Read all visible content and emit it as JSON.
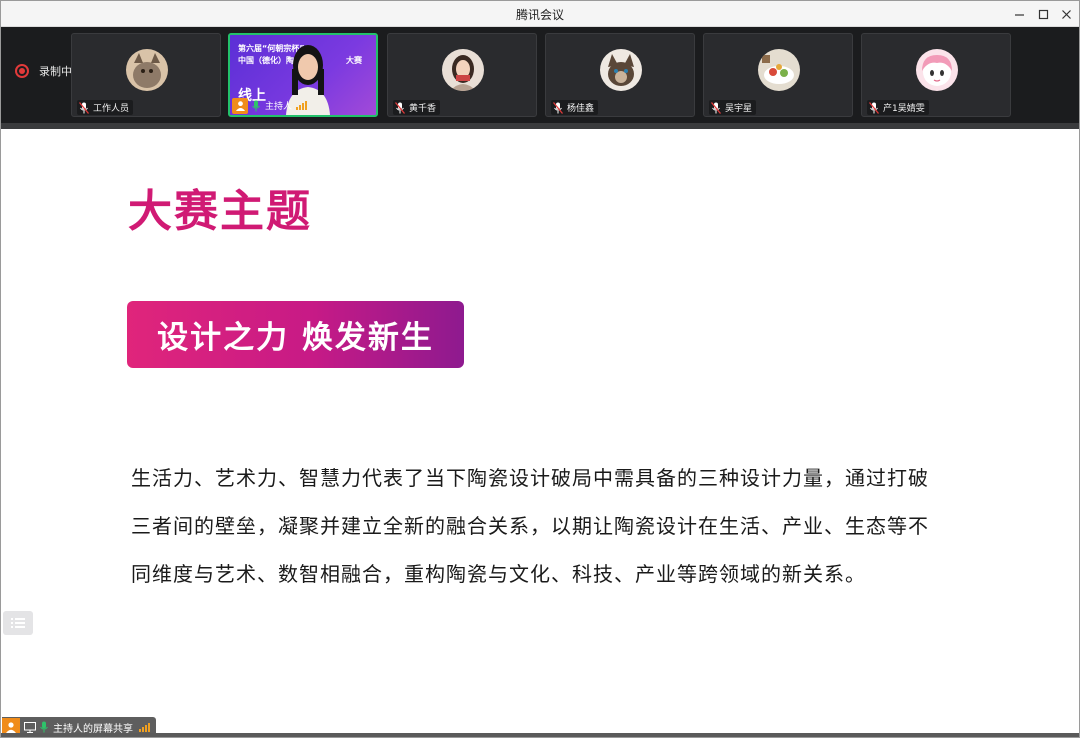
{
  "window": {
    "title": "腾讯会议"
  },
  "recording": {
    "label": "录制中",
    "color": "#e23a3a"
  },
  "participants": [
    {
      "name": "工作人员",
      "mic": "muted",
      "avatar": "cat-photo"
    },
    {
      "name": "主持人",
      "mic": "active",
      "role": "host",
      "video": true
    },
    {
      "name": "黄千香",
      "mic": "muted",
      "avatar": "woman-photo"
    },
    {
      "name": "杨佳鑫",
      "mic": "muted",
      "avatar": "cat-photo"
    },
    {
      "name": "吴宇星",
      "mic": "muted",
      "avatar": "food-photo"
    },
    {
      "name": "产1吴婧雯",
      "mic": "muted",
      "avatar": "anime-photo"
    }
  ],
  "host_video": {
    "line1": "第六届“何朝宗杯”",
    "line2": "中国（德化）陶瓷",
    "line2_tail": "大赛",
    "line3": "线上"
  },
  "slide": {
    "title": "大赛主题",
    "theme": "设计之力 焕发新生",
    "paragraph_lines": [
      "生活力、艺术力、智慧力代表了当下陶瓷设计破局中需具备的三种设计力量，通过打破",
      "三者间的壁垒，凝聚并建立全新的融合关系，以期让陶瓷设计在生活、产业、生态等不",
      "同维度与艺术、数智相融合，重构陶瓷与文化、科技、产业等跨领域的新关系。"
    ],
    "title_color": "#d01a74",
    "theme_gradient": [
      "#e0257b",
      "#8e1a8f"
    ]
  },
  "share_bar": {
    "label": "主持人的屏幕共享"
  },
  "icons": {
    "record": "record-icon",
    "mic_muted": "mic-muted-icon",
    "mic_active": "mic-active-icon",
    "host_badge": "person-icon",
    "signal": "signal-bars-icon",
    "screen": "screen-share-icon",
    "list": "list-icon"
  }
}
